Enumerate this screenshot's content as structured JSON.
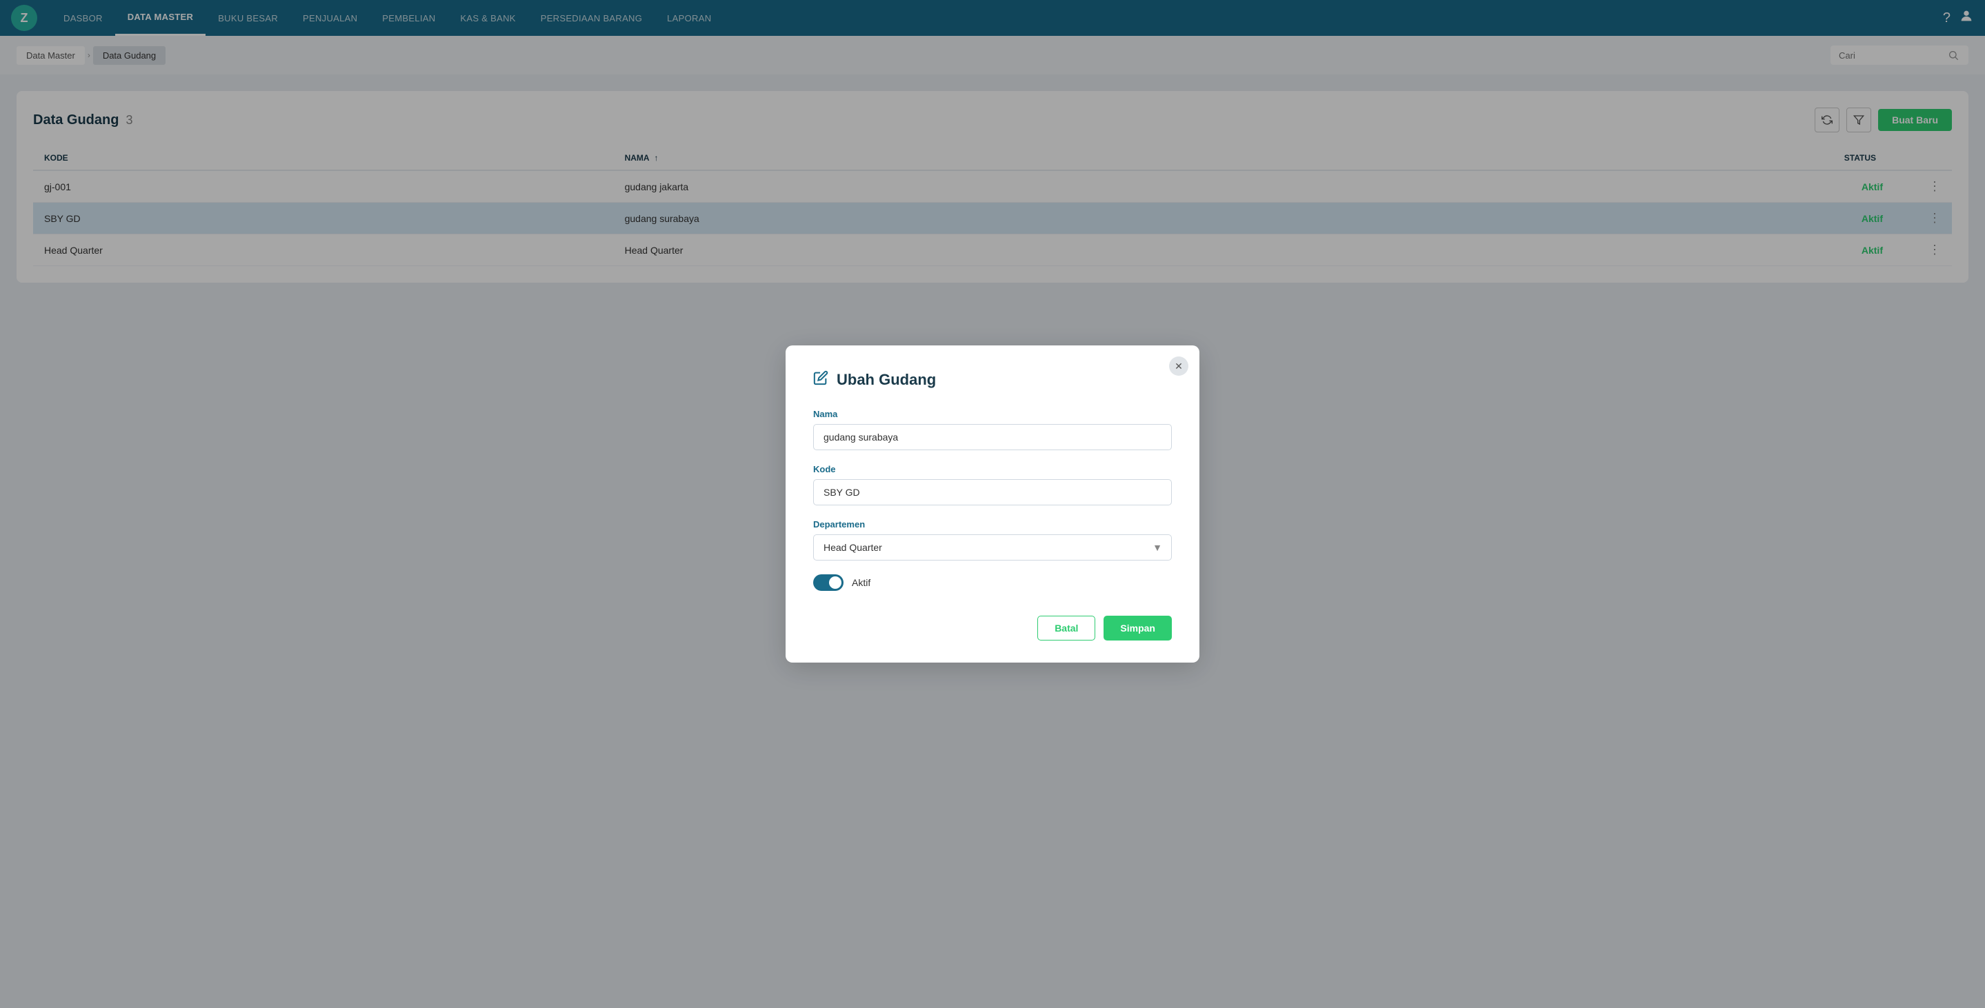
{
  "nav": {
    "logo": "Z",
    "items": [
      {
        "label": "DASBOR",
        "active": false
      },
      {
        "label": "DATA MASTER",
        "active": true
      },
      {
        "label": "BUKU BESAR",
        "active": false
      },
      {
        "label": "PENJUALAN",
        "active": false
      },
      {
        "label": "PEMBELIAN",
        "active": false
      },
      {
        "label": "KAS & BANK",
        "active": false
      },
      {
        "label": "PERSEDIAAN BARANG",
        "active": false
      },
      {
        "label": "LAPORAN",
        "active": false
      }
    ],
    "help_icon": "?",
    "user_icon": "👤"
  },
  "breadcrumb": {
    "parent": "Data Master",
    "current": "Data Gudang"
  },
  "search": {
    "placeholder": "Cari"
  },
  "table": {
    "title": "Data Gudang",
    "count": "3",
    "columns": [
      "KODE",
      "NAMA",
      "STATUS"
    ],
    "rows": [
      {
        "kode": "gj-001",
        "nama": "gudang jakarta",
        "status": "Aktif",
        "highlighted": false
      },
      {
        "kode": "SBY GD",
        "nama": "gudang surabaya",
        "status": "Aktif",
        "highlighted": true
      },
      {
        "kode": "Head Quarter",
        "nama": "Head Quarter",
        "status": "Aktif",
        "highlighted": false
      }
    ],
    "refresh_title": "Refresh",
    "filter_title": "Filter",
    "buat_baru_label": "Buat Baru"
  },
  "modal": {
    "title": "Ubah Gudang",
    "nama_label": "Nama",
    "nama_value": "gudang surabaya",
    "kode_label": "Kode",
    "kode_value": "SBY GD",
    "departemen_label": "Departemen",
    "departemen_value": "Head Quarter",
    "toggle_label": "Aktif",
    "toggle_checked": true,
    "batal_label": "Batal",
    "simpan_label": "Simpan"
  }
}
